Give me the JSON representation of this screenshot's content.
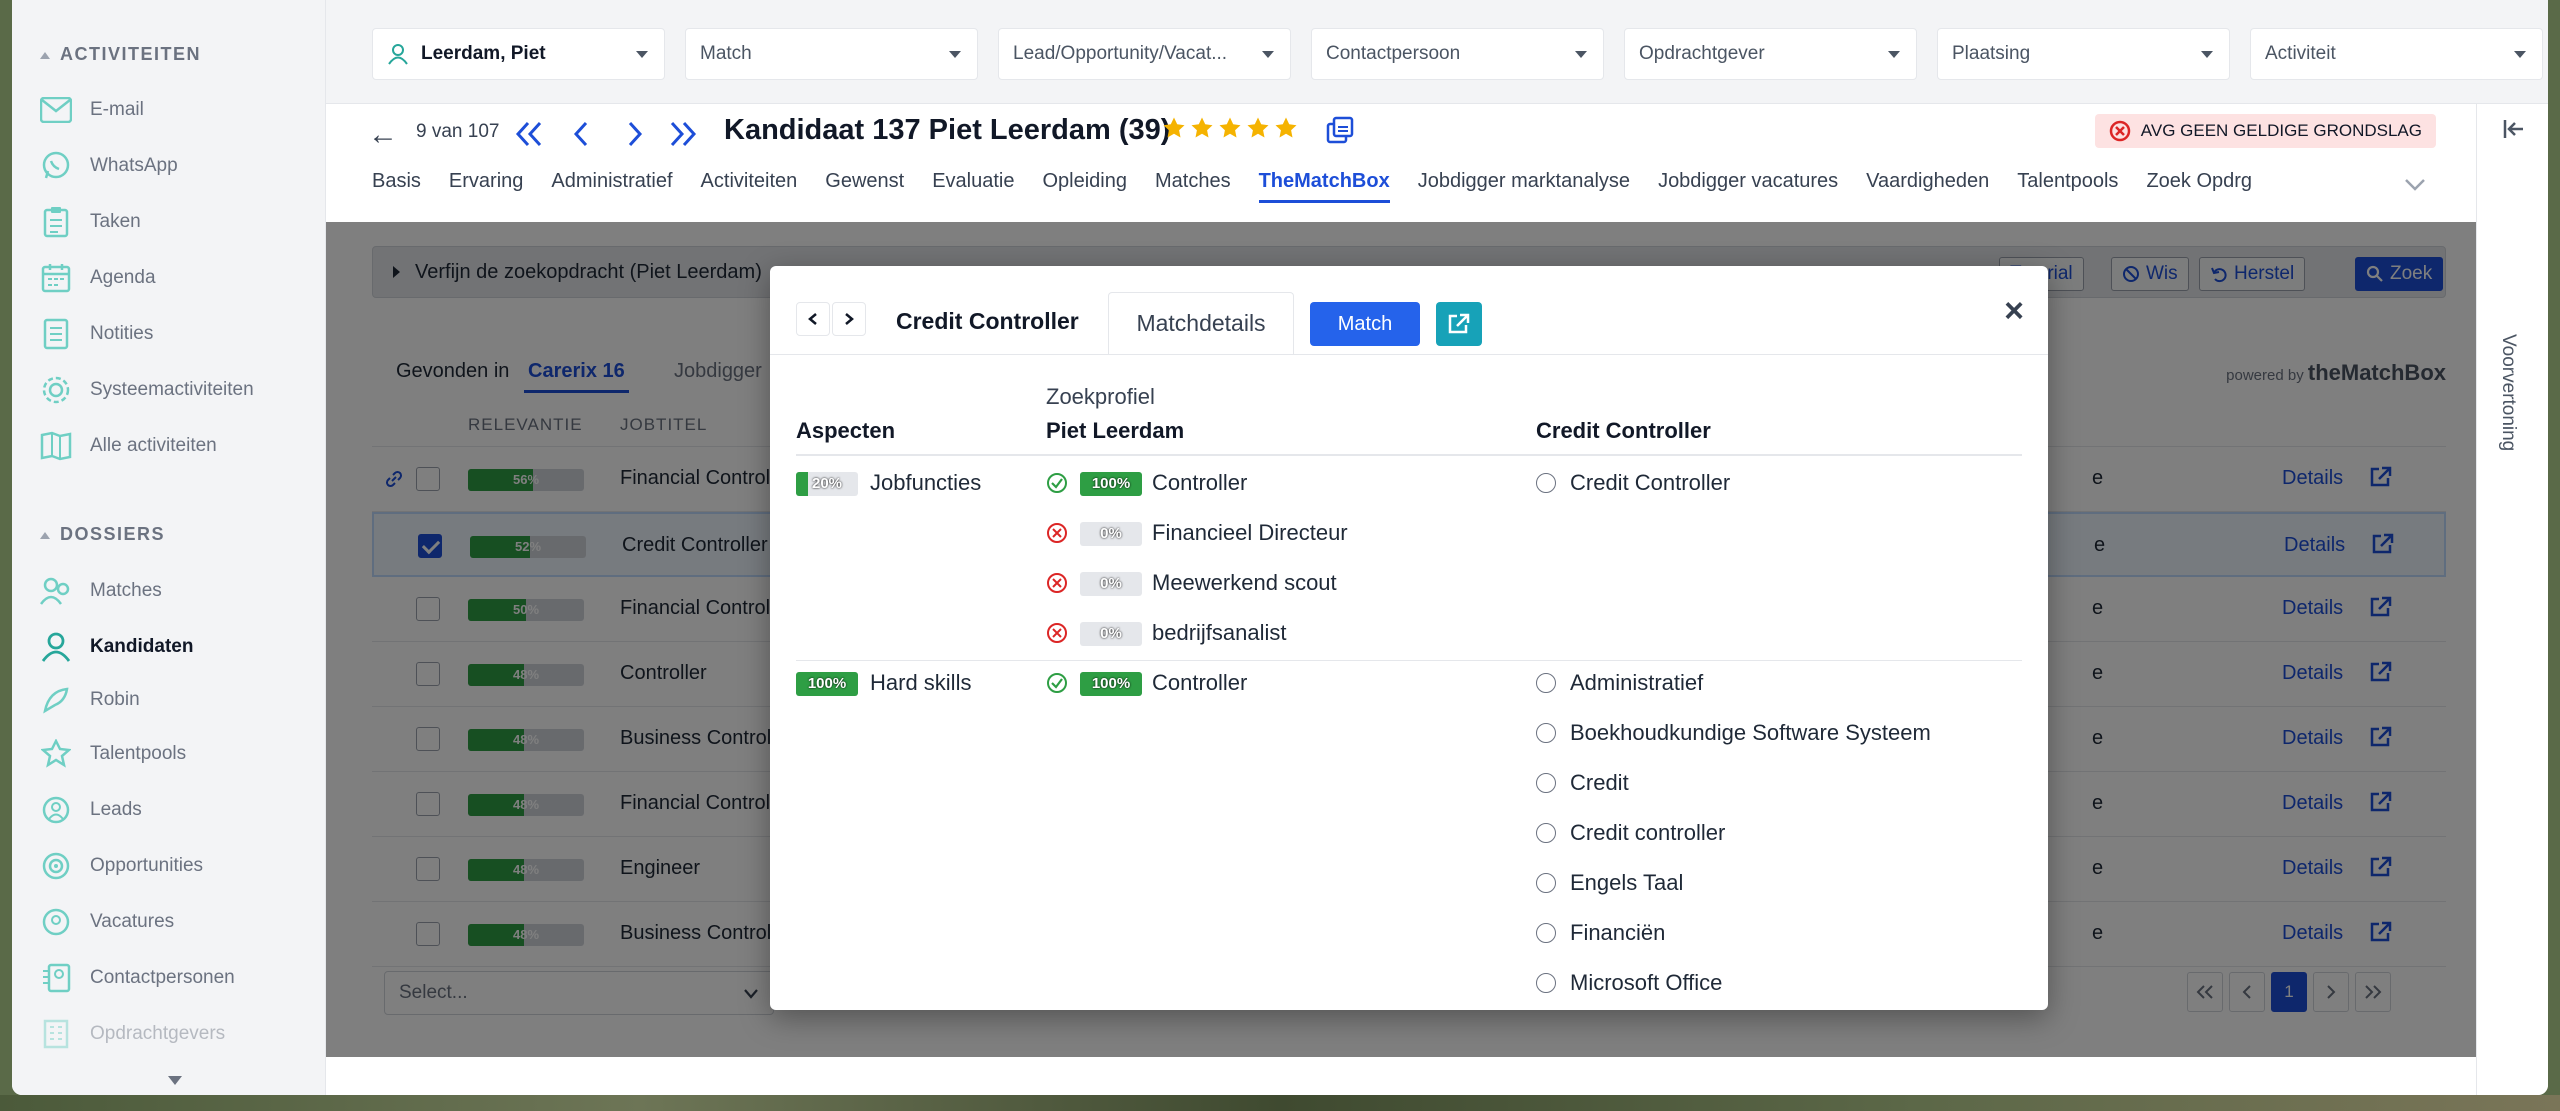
{
  "sidebar": {
    "section_activities": "ACTIVITEITEN",
    "activities": [
      {
        "label": "E-mail",
        "icon": "mail-icon"
      },
      {
        "label": "WhatsApp",
        "icon": "whatsapp-icon"
      },
      {
        "label": "Taken",
        "icon": "clipboard-icon"
      },
      {
        "label": "Agenda",
        "icon": "calendar-icon"
      },
      {
        "label": "Notities",
        "icon": "notes-icon"
      },
      {
        "label": "Systeemactiviteiten",
        "icon": "gear-icon"
      },
      {
        "label": "Alle activiteiten",
        "icon": "all-activities-icon"
      }
    ],
    "section_dossiers": "DOSSIERS",
    "dossiers": [
      {
        "label": "Matches",
        "icon": "matches-icon"
      },
      {
        "label": "Kandidaten",
        "icon": "person-icon",
        "active": true
      },
      {
        "label": "Robin",
        "icon": "robin-icon"
      },
      {
        "label": "Talentpools",
        "icon": "talentpool-icon"
      },
      {
        "label": "Leads",
        "icon": "leads-icon"
      },
      {
        "label": "Opportunities",
        "icon": "target-icon"
      },
      {
        "label": "Vacatures",
        "icon": "vacancy-icon"
      },
      {
        "label": "Contactpersonen",
        "icon": "contacts-icon"
      },
      {
        "label": "Opdrachtgevers",
        "icon": "building-icon"
      }
    ]
  },
  "filters": [
    {
      "value": "Leerdam, Piet",
      "primary": true
    },
    {
      "value": "Match"
    },
    {
      "value": "Lead/Opportunity/Vacat..."
    },
    {
      "value": "Contactpersoon"
    },
    {
      "value": "Opdrachtgever"
    },
    {
      "value": "Plaatsing"
    },
    {
      "value": "Activiteit"
    }
  ],
  "header": {
    "counter": "9 van 107",
    "title": "Kandidaat 137 Piet Leerdam (39)",
    "rating": 5,
    "avg_badge": "AVG GEEN GELDIGE GRONDSLAG",
    "tabs": [
      "Basis",
      "Ervaring",
      "Administratief",
      "Activiteiten",
      "Gewenst",
      "Evaluatie",
      "Opleiding",
      "Matches",
      "TheMatchBox",
      "Jobdigger marktanalyse",
      "Jobdigger vacatures",
      "Vaardigheden",
      "Talentpools",
      "Zoek Opdrg"
    ],
    "active_tab": "TheMatchBox"
  },
  "preview_label": "Voorvertoning",
  "search": {
    "refine_label": "Verfijn de zoekopdracht (Piet Leerdam)",
    "btn_tutorial": "Tutorial",
    "btn_wis": "Wis",
    "btn_herstel": "Herstel",
    "btn_zoek": "Zoek",
    "found_label": "Gevonden in",
    "source_active": "Carerix 16",
    "source_other": "Jobdigger",
    "powered_by": "powered by",
    "powered_brand": "theMatchBox",
    "col_relevance": "RELEVANTIE",
    "col_jobtitle": "JOBTITEL",
    "rows": [
      {
        "pct": 56,
        "job": "Financial Control",
        "e": "e",
        "linked": true,
        "checked": false
      },
      {
        "pct": 52,
        "job": "Credit Controller",
        "e": "e",
        "linked": false,
        "checked": true
      },
      {
        "pct": 50,
        "job": "Financial Control",
        "e": "e",
        "linked": false,
        "checked": false
      },
      {
        "pct": 48,
        "job": "Controller",
        "e": "e",
        "linked": false,
        "checked": false
      },
      {
        "pct": 48,
        "job": "Business Control",
        "e": "e",
        "linked": false,
        "checked": false
      },
      {
        "pct": 48,
        "job": "Financial Control",
        "e": "e",
        "linked": false,
        "checked": false
      },
      {
        "pct": 48,
        "job": "Engineer",
        "e": "e",
        "linked": false,
        "checked": false
      },
      {
        "pct": 48,
        "job": "Business Control",
        "e": "e",
        "linked": false,
        "checked": false
      }
    ],
    "details_label": "Details",
    "select_placeholder": "Select...",
    "current_page": "1"
  },
  "modal": {
    "title": "Credit Controller",
    "tab": "Matchdetails",
    "match_btn": "Match",
    "col_aspect": "Aspecten",
    "col_profile_sub": "Zoekprofiel",
    "col_profile": "Piet Leerdam",
    "col_vacancy": "Credit Controller",
    "sections": [
      {
        "pct": 20,
        "aspect": "Jobfuncties",
        "profile_items": [
          {
            "status": "match",
            "pct": 100,
            "label": "Controller"
          },
          {
            "status": "nomatch",
            "pct": 0,
            "label": "Financieel Directeur"
          },
          {
            "status": "nomatch",
            "pct": 0,
            "label": "Meewerkend scout"
          },
          {
            "status": "nomatch",
            "pct": 0,
            "label": "bedrijfsanalist"
          }
        ],
        "vacancy_items": [
          "Credit Controller"
        ]
      },
      {
        "pct": 100,
        "aspect": "Hard skills",
        "profile_items": [
          {
            "status": "match",
            "pct": 100,
            "label": "Controller"
          }
        ],
        "vacancy_items": [
          "Administratief",
          "Boekhoudkundige Software Systeem",
          "Credit",
          "Credit controller",
          "Engels Taal",
          "Financiën",
          "Microsoft Office"
        ]
      }
    ]
  },
  "colors": {
    "accent": "#1d4ed8",
    "match_green": "#2e9e44",
    "nomatch_red": "#dc2626",
    "star": "#f5b301"
  }
}
